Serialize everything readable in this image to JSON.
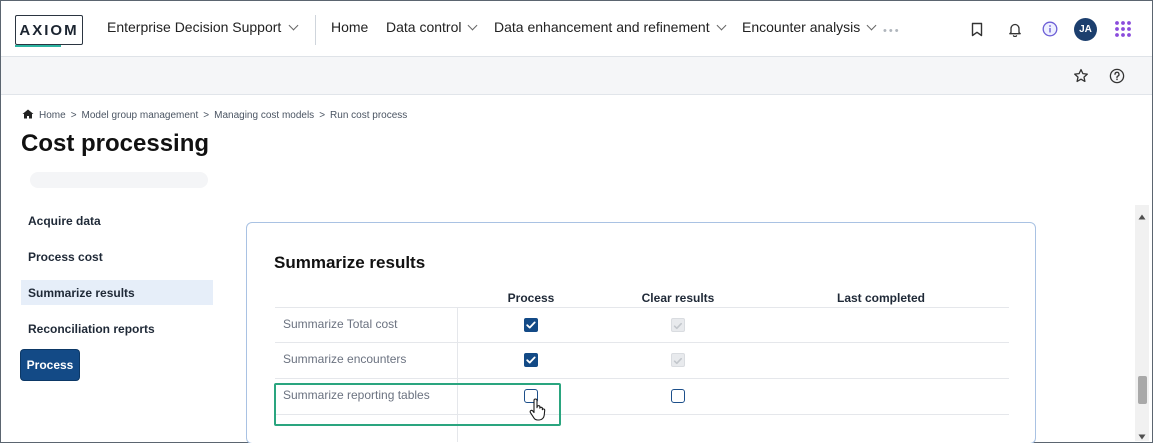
{
  "app": {
    "logo": "AXIOM",
    "product": "Enterprise Decision Support"
  },
  "nav": {
    "items": [
      {
        "label": "Home",
        "dropdown": false
      },
      {
        "label": "Data control",
        "dropdown": true
      },
      {
        "label": "Data enhancement and refinement",
        "dropdown": true
      },
      {
        "label": "Encounter analysis",
        "dropdown": true
      }
    ],
    "more": "•••",
    "avatar_initials": "JA"
  },
  "icons": {
    "bookmark": "bookmark-icon",
    "bell": "bell-icon",
    "info": "info-icon",
    "apps": "apps-grid-icon",
    "star": "star-icon",
    "help": "help-icon",
    "home": "home-icon"
  },
  "breadcrumb": {
    "items": [
      "Home",
      "Model group management",
      "Managing cost models",
      "Run cost process"
    ]
  },
  "page": {
    "title": "Cost processing"
  },
  "left_nav": {
    "items": [
      {
        "label": "Acquire data",
        "active": false
      },
      {
        "label": "Process cost",
        "active": false
      },
      {
        "label": "Summarize results",
        "active": true
      },
      {
        "label": "Reconciliation reports",
        "active": false
      }
    ],
    "process_button": "Process"
  },
  "summary": {
    "title": "Summarize results",
    "columns": [
      "Process",
      "Clear results",
      "Last completed"
    ],
    "rows": [
      {
        "label": "Summarize Total cost",
        "process": true,
        "clear": "disabled-checked",
        "last_completed": ""
      },
      {
        "label": "Summarize encounters",
        "process": true,
        "clear": "disabled-checked",
        "last_completed": ""
      },
      {
        "label": "Summarize reporting tables",
        "process": false,
        "clear": "unchecked",
        "last_completed": ""
      }
    ]
  },
  "colors": {
    "brand_navy": "#134a86",
    "avatar": "#1c3f6e",
    "highlight": "#2aa57f",
    "apps_icon": "#8a4bdc",
    "info_icon": "#6d5fd6"
  }
}
